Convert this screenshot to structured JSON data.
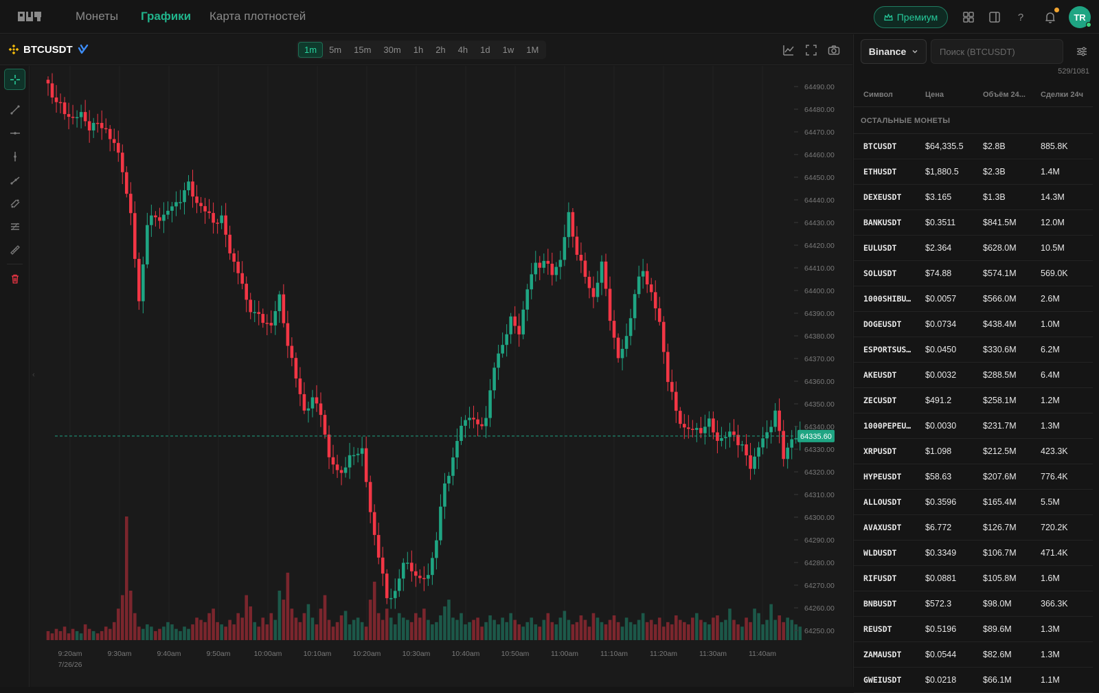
{
  "nav": {
    "items": [
      {
        "label": "Монеты",
        "active": false
      },
      {
        "label": "Графики",
        "active": true
      },
      {
        "label": "Карта плотностей",
        "active": false
      }
    ],
    "premium_label": "Премиум",
    "avatar_initials": "TR",
    "accent_color": "#21b38b"
  },
  "chart_header": {
    "symbol": "BTCUSDT",
    "timeframes": [
      "1m",
      "5m",
      "15m",
      "30m",
      "1h",
      "2h",
      "4h",
      "1d",
      "1w",
      "1M"
    ],
    "active_timeframe": "1m"
  },
  "sidebar": {
    "exchange": "Binance",
    "search_placeholder": "Поиск (BTCUSDT)",
    "count": "529/1081",
    "columns": [
      "Символ",
      "Цена",
      "Объём 24...",
      "Сделки 24ч"
    ],
    "section_title": "ОСТАЛЬНЫЕ МОНЕТЫ",
    "rows": [
      {
        "symbol": "BTCUSDT",
        "price": "$64,335.5",
        "volume": "$2.8B",
        "trades": "885.8K"
      },
      {
        "symbol": "ETHUSDT",
        "price": "$1,880.5",
        "volume": "$2.3B",
        "trades": "1.4M"
      },
      {
        "symbol": "DEXEUSDT",
        "price": "$3.165",
        "volume": "$1.3B",
        "trades": "14.3M"
      },
      {
        "symbol": "BANKUSDT",
        "price": "$0.3511",
        "volume": "$841.5M",
        "trades": "12.0M"
      },
      {
        "symbol": "EULUSDT",
        "price": "$2.364",
        "volume": "$628.0M",
        "trades": "10.5M"
      },
      {
        "symbol": "SOLUSDT",
        "price": "$74.88",
        "volume": "$574.1M",
        "trades": "569.0K"
      },
      {
        "symbol": "1000SHIBU…",
        "price": "$0.0057",
        "volume": "$566.0M",
        "trades": "2.6M"
      },
      {
        "symbol": "DOGEUSDT",
        "price": "$0.0734",
        "volume": "$438.4M",
        "trades": "1.0M"
      },
      {
        "symbol": "ESPORTSUS…",
        "price": "$0.0450",
        "volume": "$330.6M",
        "trades": "6.2M"
      },
      {
        "symbol": "AKEUSDT",
        "price": "$0.0032",
        "volume": "$288.5M",
        "trades": "6.4M"
      },
      {
        "symbol": "ZECUSDT",
        "price": "$491.2",
        "volume": "$258.1M",
        "trades": "1.2M"
      },
      {
        "symbol": "1000PEPEU…",
        "price": "$0.0030",
        "volume": "$231.7M",
        "trades": "1.3M"
      },
      {
        "symbol": "XRPUSDT",
        "price": "$1.098",
        "volume": "$212.5M",
        "trades": "423.3K"
      },
      {
        "symbol": "HYPEUSDT",
        "price": "$58.63",
        "volume": "$207.6M",
        "trades": "776.4K"
      },
      {
        "symbol": "ALLOUSDT",
        "price": "$0.3596",
        "volume": "$165.4M",
        "trades": "5.5M"
      },
      {
        "symbol": "AVAXUSDT",
        "price": "$6.772",
        "volume": "$126.7M",
        "trades": "720.2K"
      },
      {
        "symbol": "WLDUSDT",
        "price": "$0.3349",
        "volume": "$106.7M",
        "trades": "471.4K"
      },
      {
        "symbol": "RIFUSDT",
        "price": "$0.0881",
        "volume": "$105.8M",
        "trades": "1.6M"
      },
      {
        "symbol": "BNBUSDT",
        "price": "$572.3",
        "volume": "$98.0M",
        "trades": "366.3K"
      },
      {
        "symbol": "REUSDT",
        "price": "$0.5196",
        "volume": "$89.6M",
        "trades": "1.3M"
      },
      {
        "symbol": "ZAMAUSDT",
        "price": "$0.0544",
        "volume": "$82.6M",
        "trades": "1.3M"
      },
      {
        "symbol": "GWEIUSDT",
        "price": "$0.0218",
        "volume": "$66.1M",
        "trades": "1.1M"
      }
    ]
  },
  "chart_data": {
    "type": "candlestick",
    "up_color": "#1fa583",
    "down_color": "#f23645",
    "current_price": 64335.6,
    "current_price_label": "64335.60",
    "y_range": [
      64245,
      64495
    ],
    "y_ticks": [
      "64490.00",
      "64480.00",
      "64470.00",
      "64460.00",
      "64450.00",
      "64440.00",
      "64430.00",
      "64420.00",
      "64410.00",
      "64400.00",
      "64390.00",
      "64380.00",
      "64370.00",
      "64360.00",
      "64350.00",
      "64340.00",
      "64330.00",
      "64320.00",
      "64310.00",
      "64300.00",
      "64290.00",
      "64280.00",
      "64270.00",
      "64260.00",
      "64250.00"
    ],
    "x_ticks": [
      "9:20am",
      "9:30am",
      "9:40am",
      "9:50am",
      "10:00am",
      "10:10am",
      "10:20am",
      "10:30am",
      "10:40am",
      "10:50am",
      "11:00am",
      "11:10am",
      "11:20am",
      "11:30am",
      "11:40am"
    ],
    "date_label": "7/26/26",
    "close_anchors": [
      [
        0,
        64490
      ],
      [
        4,
        64478
      ],
      [
        8,
        64476
      ],
      [
        12,
        64472
      ],
      [
        14,
        64472
      ],
      [
        18,
        64455
      ],
      [
        20,
        64432
      ],
      [
        22,
        64395
      ],
      [
        24,
        64430
      ],
      [
        26,
        64432
      ],
      [
        28,
        64433
      ],
      [
        30,
        64436
      ],
      [
        32,
        64442
      ],
      [
        34,
        64445
      ],
      [
        36,
        64440
      ],
      [
        38,
        64434
      ],
      [
        40,
        64432
      ],
      [
        42,
        64430
      ],
      [
        44,
        64418
      ],
      [
        46,
        64408
      ],
      [
        48,
        64395
      ],
      [
        50,
        64390
      ],
      [
        52,
        64386
      ],
      [
        54,
        64386
      ],
      [
        56,
        64395
      ],
      [
        58,
        64378
      ],
      [
        60,
        64360
      ],
      [
        62,
        64348
      ],
      [
        64,
        64350
      ],
      [
        66,
        64348
      ],
      [
        68,
        64325
      ],
      [
        70,
        64320
      ],
      [
        72,
        64322
      ],
      [
        74,
        64328
      ],
      [
        76,
        64330
      ],
      [
        78,
        64300
      ],
      [
        80,
        64285
      ],
      [
        82,
        64262
      ],
      [
        84,
        64268
      ],
      [
        86,
        64278
      ],
      [
        88,
        64279
      ],
      [
        90,
        64270
      ],
      [
        92,
        64275
      ],
      [
        94,
        64290
      ],
      [
        96,
        64315
      ],
      [
        98,
        64325
      ],
      [
        100,
        64340
      ],
      [
        102,
        64346
      ],
      [
        104,
        64338
      ],
      [
        106,
        64345
      ],
      [
        108,
        64365
      ],
      [
        110,
        64378
      ],
      [
        112,
        64385
      ],
      [
        114,
        64383
      ],
      [
        116,
        64400
      ],
      [
        118,
        64412
      ],
      [
        120,
        64412
      ],
      [
        122,
        64408
      ],
      [
        124,
        64414
      ],
      [
        126,
        64432
      ],
      [
        128,
        64418
      ],
      [
        130,
        64405
      ],
      [
        132,
        64398
      ],
      [
        134,
        64410
      ],
      [
        136,
        64390
      ],
      [
        138,
        64368
      ],
      [
        140,
        64380
      ],
      [
        142,
        64398
      ],
      [
        144,
        64410
      ],
      [
        146,
        64398
      ],
      [
        148,
        64385
      ],
      [
        150,
        64362
      ],
      [
        152,
        64345
      ],
      [
        154,
        64340
      ],
      [
        156,
        64337
      ],
      [
        158,
        64340
      ],
      [
        160,
        64340
      ],
      [
        162,
        64335
      ],
      [
        164,
        64335
      ],
      [
        166,
        64337
      ],
      [
        168,
        64330
      ],
      [
        170,
        64322
      ],
      [
        172,
        64332
      ],
      [
        174,
        64335
      ],
      [
        176,
        64348
      ],
      [
        178,
        64325
      ],
      [
        180,
        64336
      ]
    ],
    "volumes": [
      4,
      3,
      5,
      4,
      6,
      3,
      5,
      4,
      3,
      7,
      5,
      4,
      3,
      4,
      6,
      5,
      8,
      14,
      20,
      55,
      22,
      12,
      6,
      5,
      7,
      6,
      4,
      5,
      6,
      8,
      7,
      5,
      4,
      6,
      5,
      7,
      10,
      9,
      8,
      12,
      14,
      8,
      7,
      6,
      9,
      7,
      12,
      10,
      20,
      15,
      8,
      6,
      10,
      7,
      12,
      9,
      22,
      18,
      30,
      14,
      10,
      8,
      12,
      16,
      10,
      7,
      14,
      20,
      9,
      6,
      8,
      11,
      13,
      7,
      9,
      10,
      8,
      6,
      18,
      26,
      12,
      9,
      14,
      10,
      7,
      12,
      10,
      9,
      8,
      12,
      10,
      14,
      9,
      7,
      8,
      11,
      15,
      18,
      10,
      9,
      12,
      7,
      8,
      9,
      10,
      6,
      8,
      11,
      9,
      7,
      10,
      8,
      12,
      9,
      7,
      6,
      8,
      10,
      7,
      6,
      9,
      12,
      8,
      7,
      10,
      13,
      9,
      7,
      8,
      11,
      9,
      6,
      12,
      10,
      8,
      7,
      9,
      11,
      8,
      6,
      10,
      8,
      7,
      9,
      12,
      8,
      9,
      7,
      10,
      6,
      8,
      7,
      11,
      9,
      8,
      7,
      10,
      12,
      9,
      8,
      7,
      10,
      11,
      8,
      9,
      14,
      9,
      7,
      6,
      10,
      8,
      14,
      12,
      7,
      9,
      16,
      9,
      11,
      8,
      10,
      9,
      7,
      6
    ]
  }
}
